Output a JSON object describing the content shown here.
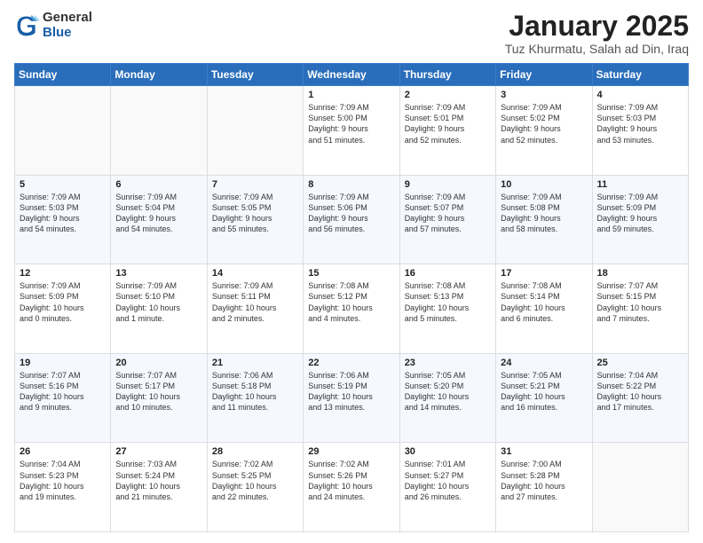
{
  "logo": {
    "general": "General",
    "blue": "Blue"
  },
  "title": "January 2025",
  "subtitle": "Tuz Khurmatu, Salah ad Din, Iraq",
  "days_of_week": [
    "Sunday",
    "Monday",
    "Tuesday",
    "Wednesday",
    "Thursday",
    "Friday",
    "Saturday"
  ],
  "weeks": [
    [
      {
        "day": "",
        "content": ""
      },
      {
        "day": "",
        "content": ""
      },
      {
        "day": "",
        "content": ""
      },
      {
        "day": "1",
        "content": "Sunrise: 7:09 AM\nSunset: 5:00 PM\nDaylight: 9 hours\nand 51 minutes."
      },
      {
        "day": "2",
        "content": "Sunrise: 7:09 AM\nSunset: 5:01 PM\nDaylight: 9 hours\nand 52 minutes."
      },
      {
        "day": "3",
        "content": "Sunrise: 7:09 AM\nSunset: 5:02 PM\nDaylight: 9 hours\nand 52 minutes."
      },
      {
        "day": "4",
        "content": "Sunrise: 7:09 AM\nSunset: 5:03 PM\nDaylight: 9 hours\nand 53 minutes."
      }
    ],
    [
      {
        "day": "5",
        "content": "Sunrise: 7:09 AM\nSunset: 5:03 PM\nDaylight: 9 hours\nand 54 minutes."
      },
      {
        "day": "6",
        "content": "Sunrise: 7:09 AM\nSunset: 5:04 PM\nDaylight: 9 hours\nand 54 minutes."
      },
      {
        "day": "7",
        "content": "Sunrise: 7:09 AM\nSunset: 5:05 PM\nDaylight: 9 hours\nand 55 minutes."
      },
      {
        "day": "8",
        "content": "Sunrise: 7:09 AM\nSunset: 5:06 PM\nDaylight: 9 hours\nand 56 minutes."
      },
      {
        "day": "9",
        "content": "Sunrise: 7:09 AM\nSunset: 5:07 PM\nDaylight: 9 hours\nand 57 minutes."
      },
      {
        "day": "10",
        "content": "Sunrise: 7:09 AM\nSunset: 5:08 PM\nDaylight: 9 hours\nand 58 minutes."
      },
      {
        "day": "11",
        "content": "Sunrise: 7:09 AM\nSunset: 5:09 PM\nDaylight: 9 hours\nand 59 minutes."
      }
    ],
    [
      {
        "day": "12",
        "content": "Sunrise: 7:09 AM\nSunset: 5:09 PM\nDaylight: 10 hours\nand 0 minutes."
      },
      {
        "day": "13",
        "content": "Sunrise: 7:09 AM\nSunset: 5:10 PM\nDaylight: 10 hours\nand 1 minute."
      },
      {
        "day": "14",
        "content": "Sunrise: 7:09 AM\nSunset: 5:11 PM\nDaylight: 10 hours\nand 2 minutes."
      },
      {
        "day": "15",
        "content": "Sunrise: 7:08 AM\nSunset: 5:12 PM\nDaylight: 10 hours\nand 4 minutes."
      },
      {
        "day": "16",
        "content": "Sunrise: 7:08 AM\nSunset: 5:13 PM\nDaylight: 10 hours\nand 5 minutes."
      },
      {
        "day": "17",
        "content": "Sunrise: 7:08 AM\nSunset: 5:14 PM\nDaylight: 10 hours\nand 6 minutes."
      },
      {
        "day": "18",
        "content": "Sunrise: 7:07 AM\nSunset: 5:15 PM\nDaylight: 10 hours\nand 7 minutes."
      }
    ],
    [
      {
        "day": "19",
        "content": "Sunrise: 7:07 AM\nSunset: 5:16 PM\nDaylight: 10 hours\nand 9 minutes."
      },
      {
        "day": "20",
        "content": "Sunrise: 7:07 AM\nSunset: 5:17 PM\nDaylight: 10 hours\nand 10 minutes."
      },
      {
        "day": "21",
        "content": "Sunrise: 7:06 AM\nSunset: 5:18 PM\nDaylight: 10 hours\nand 11 minutes."
      },
      {
        "day": "22",
        "content": "Sunrise: 7:06 AM\nSunset: 5:19 PM\nDaylight: 10 hours\nand 13 minutes."
      },
      {
        "day": "23",
        "content": "Sunrise: 7:05 AM\nSunset: 5:20 PM\nDaylight: 10 hours\nand 14 minutes."
      },
      {
        "day": "24",
        "content": "Sunrise: 7:05 AM\nSunset: 5:21 PM\nDaylight: 10 hours\nand 16 minutes."
      },
      {
        "day": "25",
        "content": "Sunrise: 7:04 AM\nSunset: 5:22 PM\nDaylight: 10 hours\nand 17 minutes."
      }
    ],
    [
      {
        "day": "26",
        "content": "Sunrise: 7:04 AM\nSunset: 5:23 PM\nDaylight: 10 hours\nand 19 minutes."
      },
      {
        "day": "27",
        "content": "Sunrise: 7:03 AM\nSunset: 5:24 PM\nDaylight: 10 hours\nand 21 minutes."
      },
      {
        "day": "28",
        "content": "Sunrise: 7:02 AM\nSunset: 5:25 PM\nDaylight: 10 hours\nand 22 minutes."
      },
      {
        "day": "29",
        "content": "Sunrise: 7:02 AM\nSunset: 5:26 PM\nDaylight: 10 hours\nand 24 minutes."
      },
      {
        "day": "30",
        "content": "Sunrise: 7:01 AM\nSunset: 5:27 PM\nDaylight: 10 hours\nand 26 minutes."
      },
      {
        "day": "31",
        "content": "Sunrise: 7:00 AM\nSunset: 5:28 PM\nDaylight: 10 hours\nand 27 minutes."
      },
      {
        "day": "",
        "content": ""
      }
    ]
  ]
}
